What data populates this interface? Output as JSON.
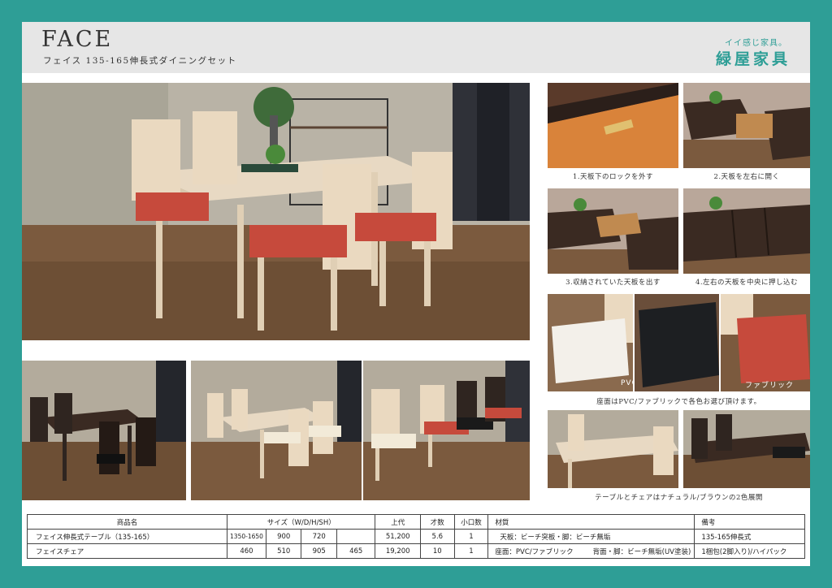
{
  "header": {
    "title": "FACE",
    "subtitle": "フェイス 135-165伸長式ダイニングセット",
    "brand_tagline": "イイ感じ家具。",
    "brand_name": "緑屋家具"
  },
  "steps": [
    {
      "caption": "1.天板下のロックを外す"
    },
    {
      "caption": "2.天板を左右に開く"
    },
    {
      "caption": "3.収納されていた天板を出す"
    },
    {
      "caption": "4.左右の天板を中央に押し込む"
    }
  ],
  "seats": {
    "pvc_label": "PVC",
    "fabric_label": "ファブリック",
    "caption": "座面はPVC/ファブリックで各色お選び頂けます。"
  },
  "colors_caption": "テーブルとチェアはナチュラル/ブラウンの2色展開",
  "palette": {
    "frame": "#2e9e96",
    "natural_wood": "#e8d9c3",
    "brown": "#3a2a22",
    "red_seat": "#c64a3c",
    "floor": "#7b5a3e"
  },
  "table": {
    "headers": {
      "name": "商品名",
      "size": "サイズ（W/D/H/SH）",
      "price": "上代",
      "volume": "才数",
      "units": "小口数",
      "material": "材質",
      "notes": "備考"
    },
    "rows": [
      {
        "name": "フェイス伸長式テーブル（135-165）",
        "w": "1350-1650",
        "d": "900",
        "h": "720",
        "sh": "",
        "price": "51,200",
        "volume": "5.6",
        "units": "1",
        "material_a": "天板：ビーチ突板・脚：ビーチ無垢",
        "material_b": "",
        "notes": "135-165伸長式"
      },
      {
        "name": "フェイスチェア",
        "w": "460",
        "d": "510",
        "h": "905",
        "sh": "465",
        "price": "19,200",
        "volume": "10",
        "units": "1",
        "material_a": "座面：PVC/ファブリック",
        "material_b": "背面・脚：ビーチ無垢(UV塗装)",
        "notes": "1梱包(2脚入り)/ハイパック"
      }
    ]
  }
}
